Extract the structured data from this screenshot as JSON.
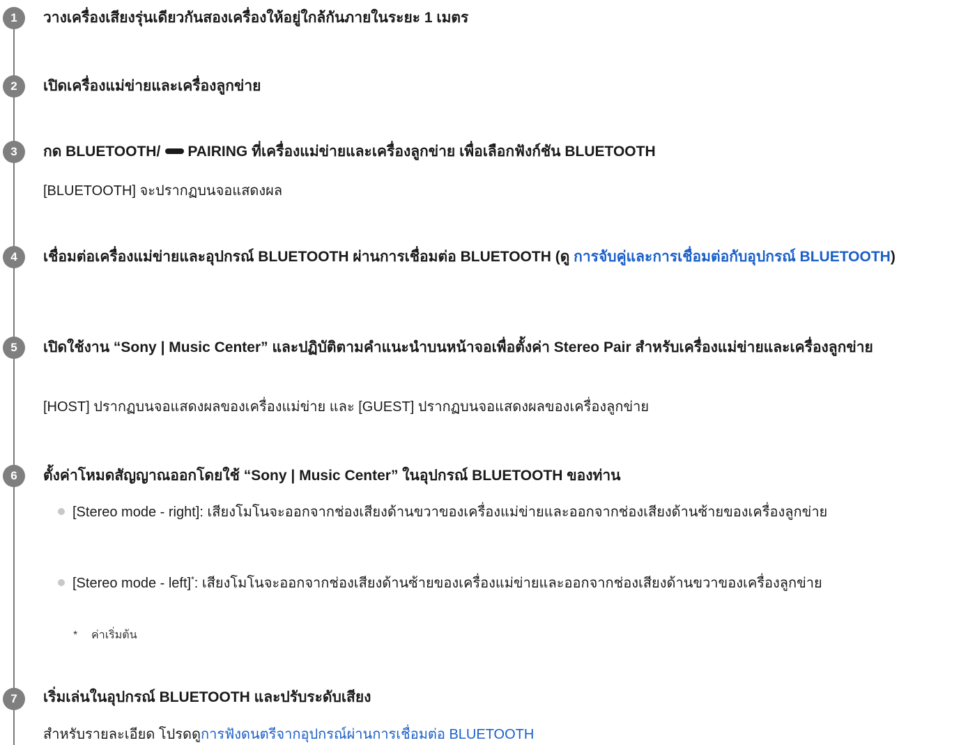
{
  "steps": [
    {
      "number": "1",
      "heading": "วางเครื่องเสียงรุ่นเดียวกันสองเครื่องให้อยู่ใกล้กันภายในระยะ 1 เมตร"
    },
    {
      "number": "2",
      "heading": "เปิดเครื่องแม่ข่ายและเครื่องลูกข่าย"
    },
    {
      "number": "3",
      "heading_before_icon": "กด BLUETOOTH/",
      "heading_after_icon": "PAIRING ที่เครื่องแม่ข่ายและเครื่องลูกข่าย เพื่อเลือกฟังก์ชัน BLUETOOTH",
      "icon": "dash-pairing-icon",
      "description": "[BLUETOOTH] จะปรากฏบนจอแสดงผล"
    },
    {
      "number": "4",
      "heading_before_link": "เชื่อมต่อเครื่องแม่ข่ายและอุปกรณ์ BLUETOOTH ผ่านการเชื่อมต่อ BLUETOOTH (ดู ",
      "link_text": "การจับคู่และการเชื่อมต่อกับอุปกรณ์ BLUETOOTH",
      "heading_after_link": ")"
    },
    {
      "number": "5",
      "heading": "เปิดใช้งาน “Sony | Music Center” และปฏิบัติตามคำแนะนำบนหน้าจอเพื่อตั้งค่า Stereo Pair สำหรับเครื่องแม่ข่ายและเครื่องลูกข่าย",
      "description": "[HOST] ปรากฏบนจอแสดงผลของเครื่องแม่ข่าย และ [GUEST] ปรากฏบนจอแสดงผลของเครื่องลูกข่าย"
    },
    {
      "number": "6",
      "heading": "ตั้งค่าโหมดสัญญาณออกโดยใช้ “Sony | Music Center” ในอุปกรณ์ BLUETOOTH ของท่าน",
      "bullets": [
        {
          "label": "[Stereo mode - right]",
          "text": ": เสียงโมโนจะออกจากช่องเสียงด้านขวาของเครื่องแม่ข่ายและออกจากช่องเสียงด้านซ้ายของเครื่องลูกข่าย"
        },
        {
          "label": "[Stereo mode - left]",
          "marker": "*",
          "text": ": เสียงโมโนจะออกจากช่องเสียงด้านซ้ายของเครื่องแม่ข่ายและออกจากช่องเสียงด้านขวาของเครื่องลูกข่าย"
        }
      ],
      "footnote": {
        "marker": "*",
        "text": "ค่าเริ่มต้น"
      }
    },
    {
      "number": "7",
      "heading": "เริ่มเล่นในอุปกรณ์ BLUETOOTH และปรับระดับเสียง",
      "description_before_link": "สำหรับรายละเอียด โปรดดู",
      "link_text": "การฟังดนตรีจากอุปกรณ์ผ่านการเชื่อมต่อ BLUETOOTH"
    }
  ],
  "colors": {
    "badge": "#7f7f7f",
    "rail": "#7a7a7a",
    "link": "#1a5fc8",
    "text": "#1a1a1a"
  }
}
